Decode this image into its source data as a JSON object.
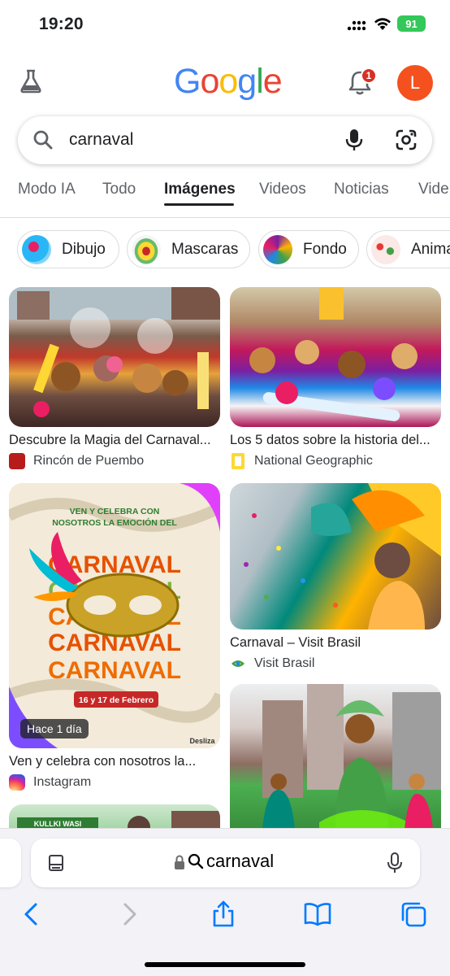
{
  "status_bar": {
    "time": "19:20",
    "battery": "91"
  },
  "header": {
    "logo_letters": [
      {
        "ch": "G",
        "color": "#4285F4"
      },
      {
        "ch": "o",
        "color": "#EA4335"
      },
      {
        "ch": "o",
        "color": "#FBBC05"
      },
      {
        "ch": "g",
        "color": "#4285F4"
      },
      {
        "ch": "l",
        "color": "#34A853"
      },
      {
        "ch": "e",
        "color": "#EA4335"
      }
    ],
    "notification_count": "1",
    "avatar_letter": "L"
  },
  "search": {
    "query": "carnaval"
  },
  "tabs": [
    "Modo IA",
    "Todo",
    "Imágenes",
    "Videos",
    "Noticias",
    "Vide"
  ],
  "active_tab": "Imágenes",
  "chips": [
    "Dibujo",
    "Mascaras",
    "Fondo",
    "Anima"
  ],
  "results": {
    "r1": {
      "title": "Descubre la Magia del Carnaval...",
      "source": "Rincón de Puembo"
    },
    "r2": {
      "title": "Los 5 datos sobre la historia del...",
      "source": "National Geographic"
    },
    "r3": {
      "title": "Ven y celebra con nosotros la...",
      "source": "Instagram",
      "time_badge": "Hace 1 día",
      "poster": {
        "top_line1": "VEN Y CELEBRA CON",
        "top_line2": "NOSOTROS LA EMOCIÓN DEL",
        "word": "CARNAVAL",
        "dates": "16 y 17 de Febrero",
        "brand": "Desliza"
      }
    },
    "r4": {
      "title": "Carnaval – Visit Brasil",
      "source": "Visit Brasil"
    },
    "r6": {
      "sign": "KULLKI WASI"
    }
  },
  "browser": {
    "url_text": "carnaval"
  },
  "colors": {
    "accent": "#1a73e8",
    "badge": "#d93025",
    "avatar": "#f4511e",
    "battery": "#34c759"
  }
}
